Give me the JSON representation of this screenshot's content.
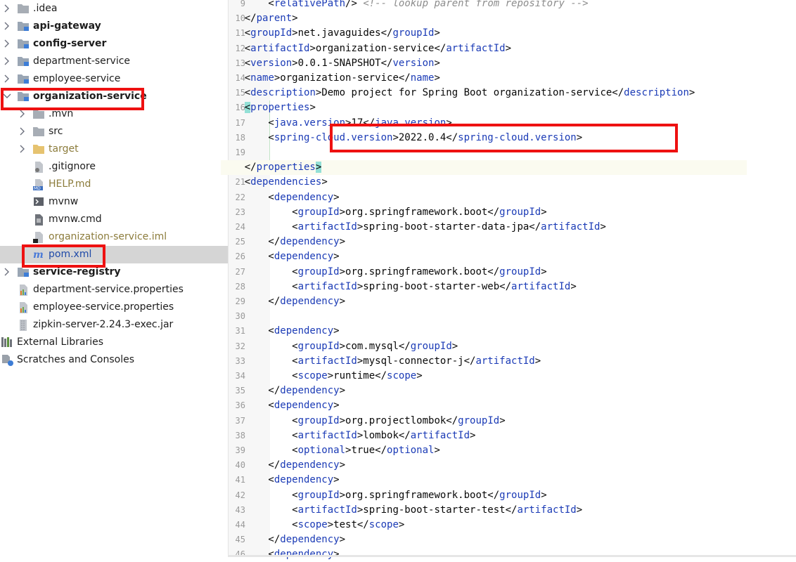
{
  "project_tree": {
    "items": [
      {
        "label": ".idea",
        "style": "normal",
        "icon": "folder-icon"
      },
      {
        "label": "api-gateway",
        "style": "bold",
        "icon": "module-folder-icon"
      },
      {
        "label": "config-server",
        "style": "bold",
        "icon": "module-folder-icon"
      },
      {
        "label": "department-service",
        "style": "normal",
        "icon": "module-folder-icon"
      },
      {
        "label": "employee-service",
        "style": "normal",
        "icon": "module-folder-icon"
      },
      {
        "label": "organization-service",
        "style": "bold",
        "icon": "module-folder-icon"
      },
      {
        "label": ".mvn",
        "style": "normal",
        "icon": "folder-icon"
      },
      {
        "label": "src",
        "style": "normal",
        "icon": "folder-icon"
      },
      {
        "label": "target",
        "style": "excluded",
        "icon": "excluded-folder-icon"
      },
      {
        "label": ".gitignore",
        "style": "normal",
        "icon": "gitignore-file-icon"
      },
      {
        "label": "HELP.md",
        "style": "muted",
        "icon": "markdown-file-icon"
      },
      {
        "label": "mvnw",
        "style": "normal",
        "icon": "shell-script-icon"
      },
      {
        "label": "mvnw.cmd",
        "style": "normal",
        "icon": "text-file-icon"
      },
      {
        "label": "organization-service.iml",
        "style": "muted",
        "icon": "iml-file-icon"
      },
      {
        "label": "pom.xml",
        "style": "blue",
        "icon": "maven-m-icon"
      },
      {
        "label": "service-registry",
        "style": "bold",
        "icon": "module-folder-icon"
      },
      {
        "label": "department-service.properties",
        "style": "normal",
        "icon": "properties-file-icon"
      },
      {
        "label": "employee-service.properties",
        "style": "normal",
        "icon": "properties-file-icon"
      },
      {
        "label": "zipkin-server-2.24.3-exec.jar",
        "style": "normal",
        "icon": "jar-file-icon"
      },
      {
        "label": "External Libraries",
        "style": "normal",
        "icon": "libraries-icon"
      },
      {
        "label": "Scratches and Consoles",
        "style": "normal",
        "icon": "scratches-icon"
      }
    ]
  },
  "editor": {
    "lines": [
      {
        "n": "9",
        "text": "        <relativePath/> <!-- lookup parent from repository -->"
      },
      {
        "n": "10",
        "text": "    </parent>"
      },
      {
        "n": "11",
        "text": "    <groupId>net.javaguides</groupId>"
      },
      {
        "n": "12",
        "text": "    <artifactId>organization-service</artifactId>"
      },
      {
        "n": "13",
        "text": "    <version>0.0.1-SNAPSHOT</version>"
      },
      {
        "n": "14",
        "text": "    <name>organization-service</name>"
      },
      {
        "n": "15",
        "text": "    <description>Demo project for Spring Boot organization-service</description>"
      },
      {
        "n": "16",
        "text": "    <properties>"
      },
      {
        "n": "17",
        "text": "        <java.version>17</java.version>"
      },
      {
        "n": "18",
        "text": "        <spring-cloud.version>2022.0.4</spring-cloud.version>"
      },
      {
        "n": "19",
        "text": ""
      },
      {
        "n": "20",
        "text": "    </properties>"
      },
      {
        "n": "21",
        "text": "    <dependencies>"
      },
      {
        "n": "22",
        "text": "        <dependency>"
      },
      {
        "n": "23",
        "text": "            <groupId>org.springframework.boot</groupId>"
      },
      {
        "n": "24",
        "text": "            <artifactId>spring-boot-starter-data-jpa</artifactId>"
      },
      {
        "n": "25",
        "text": "        </dependency>"
      },
      {
        "n": "26",
        "text": "        <dependency>"
      },
      {
        "n": "27",
        "text": "            <groupId>org.springframework.boot</groupId>"
      },
      {
        "n": "28",
        "text": "            <artifactId>spring-boot-starter-web</artifactId>"
      },
      {
        "n": "29",
        "text": "        </dependency>"
      },
      {
        "n": "30",
        "text": ""
      },
      {
        "n": "31",
        "text": "        <dependency>"
      },
      {
        "n": "32",
        "text": "            <groupId>com.mysql</groupId>"
      },
      {
        "n": "33",
        "text": "            <artifactId>mysql-connector-j</artifactId>"
      },
      {
        "n": "34",
        "text": "            <scope>runtime</scope>"
      },
      {
        "n": "35",
        "text": "        </dependency>"
      },
      {
        "n": "36",
        "text": "        <dependency>"
      },
      {
        "n": "37",
        "text": "            <groupId>org.projectlombok</groupId>"
      },
      {
        "n": "38",
        "text": "            <artifactId>lombok</artifactId>"
      },
      {
        "n": "39",
        "text": "            <optional>true</optional>"
      },
      {
        "n": "40",
        "text": "        </dependency>"
      },
      {
        "n": "41",
        "text": "        <dependency>"
      },
      {
        "n": "42",
        "text": "            <groupId>org.springframework.boot</groupId>"
      },
      {
        "n": "43",
        "text": "            <artifactId>spring-boot-starter-test</artifactId>"
      },
      {
        "n": "44",
        "text": "            <scope>test</scope>"
      },
      {
        "n": "45",
        "text": "        </dependency>"
      },
      {
        "n": "46",
        "text": "        <dependency>"
      }
    ]
  },
  "colors": {
    "tag": "#1b3bb6",
    "text": "#080808",
    "comment": "#8c8c8c",
    "annotation_box": "#ee1111",
    "bracket_match": "#93e0d6",
    "changed_line_marker": "#c3e4c7"
  }
}
